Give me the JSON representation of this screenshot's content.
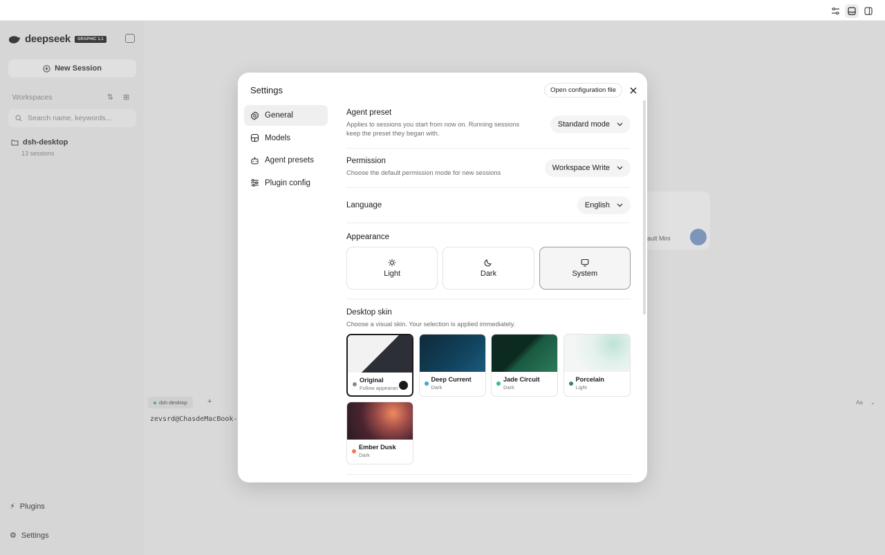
{
  "background": {
    "sidebar": {
      "logo": "deepseek",
      "logo_badge": "GRAPHIC 1.1",
      "new_session": "New Session",
      "workspaces_label": "Workspaces",
      "search_placeholder": "Search name, keywords...",
      "project_name": "dsh-desktop",
      "project_sessions": "13 sessions",
      "plugins": "Plugins",
      "settings": "Settings"
    },
    "terminal": {
      "tab_label": "dsh-desktop",
      "prompt": "zevsrd@ChasdeMacBook-P",
      "right_label": "Aa"
    },
    "composer": {
      "model_label": "Sault Mini"
    }
  },
  "modal": {
    "title": "Settings",
    "open_config": "Open configuration file",
    "nav": [
      {
        "label": "General",
        "icon": "gear-icon",
        "active": true
      },
      {
        "label": "Models",
        "icon": "database-icon",
        "active": false
      },
      {
        "label": "Agent presets",
        "icon": "robot-icon",
        "active": false
      },
      {
        "label": "Plugin config",
        "icon": "sliders-icon",
        "active": false
      }
    ],
    "general": {
      "agent_preset": {
        "title": "Agent preset",
        "desc": "Applies to sessions you start from now on. Running sessions keep the preset they began with.",
        "value": "Standard mode"
      },
      "permission": {
        "title": "Permission",
        "desc": "Choose the default permission mode for new sessions",
        "value": "Workspace Write"
      },
      "language": {
        "title": "Language",
        "value": "English"
      },
      "appearance": {
        "title": "Appearance",
        "options": [
          {
            "label": "Light",
            "icon": "sun-icon"
          },
          {
            "label": "Dark",
            "icon": "moon-icon"
          },
          {
            "label": "System",
            "icon": "monitor-icon"
          }
        ],
        "selected": "System"
      },
      "desktop_skin": {
        "title": "Desktop skin",
        "desc": "Choose a visual skin. Your selection is applied immediately.",
        "skins": [
          {
            "name": "Original",
            "mode": "Follow appearance",
            "dot": "#8a8a8a",
            "selected": true
          },
          {
            "name": "Deep Current",
            "mode": "Dark",
            "dot": "#3aa6d9",
            "selected": false
          },
          {
            "name": "Jade Circuit",
            "mode": "Dark",
            "dot": "#2fbf86",
            "selected": false
          },
          {
            "name": "Porcelain",
            "mode": "Light",
            "dot": "#2e8a66",
            "selected": false
          },
          {
            "name": "Ember Dusk",
            "mode": "Dark",
            "dot": "#f07a52",
            "selected": false
          }
        ]
      }
    }
  }
}
